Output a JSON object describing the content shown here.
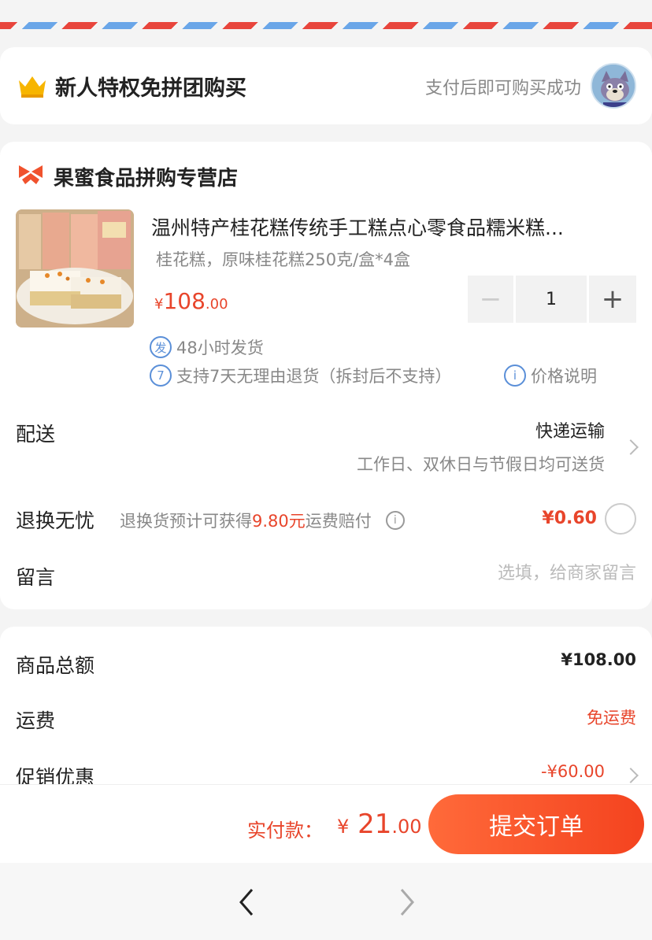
{
  "promo": {
    "title": "新人特权免拼团购买",
    "subtitle": "支付后即可购买成功"
  },
  "store": {
    "name": "果蜜食品拼购专营店"
  },
  "product": {
    "title": "温州特产桂花糕传统手工糕点心零食品糯米糕...",
    "spec": "桂花糕，原味桂花糕250克/盒*4盒",
    "price_symbol": "¥",
    "price_int": "108",
    "price_dec": ".00",
    "quantity": "1",
    "feature1_badge": "发",
    "feature1": "48小时发货",
    "feature2_badge": "7",
    "feature2": "支持7天无理由退货（拆封后不支持）",
    "price_note_badge": "i",
    "price_note": "价格说明"
  },
  "shipping": {
    "label": "配送",
    "value": "快递运输",
    "sub": "工作日、双休日与节假日均可送货"
  },
  "returns": {
    "label": "退换无忧",
    "desc_prefix": "退换货预计可获得",
    "desc_highlight": "9.80元",
    "desc_suffix": "运费赔付",
    "info_badge": "i",
    "price": "¥0.60"
  },
  "message": {
    "label": "留言",
    "placeholder": "选填，给商家留言"
  },
  "totals": {
    "goods_label": "商品总额",
    "goods_value": "¥108.00",
    "shipping_label": "运费",
    "shipping_value": "免运费",
    "promo_label": "促销优惠",
    "promo_value": "-¥60.00"
  },
  "payment": {
    "label": "实付款：",
    "symbol": "¥",
    "int": " 21",
    "dec": ".00",
    "submit_label": "提交订单"
  },
  "colors": {
    "accent": "#e8452b",
    "link_blue": "#5a8fd8"
  }
}
